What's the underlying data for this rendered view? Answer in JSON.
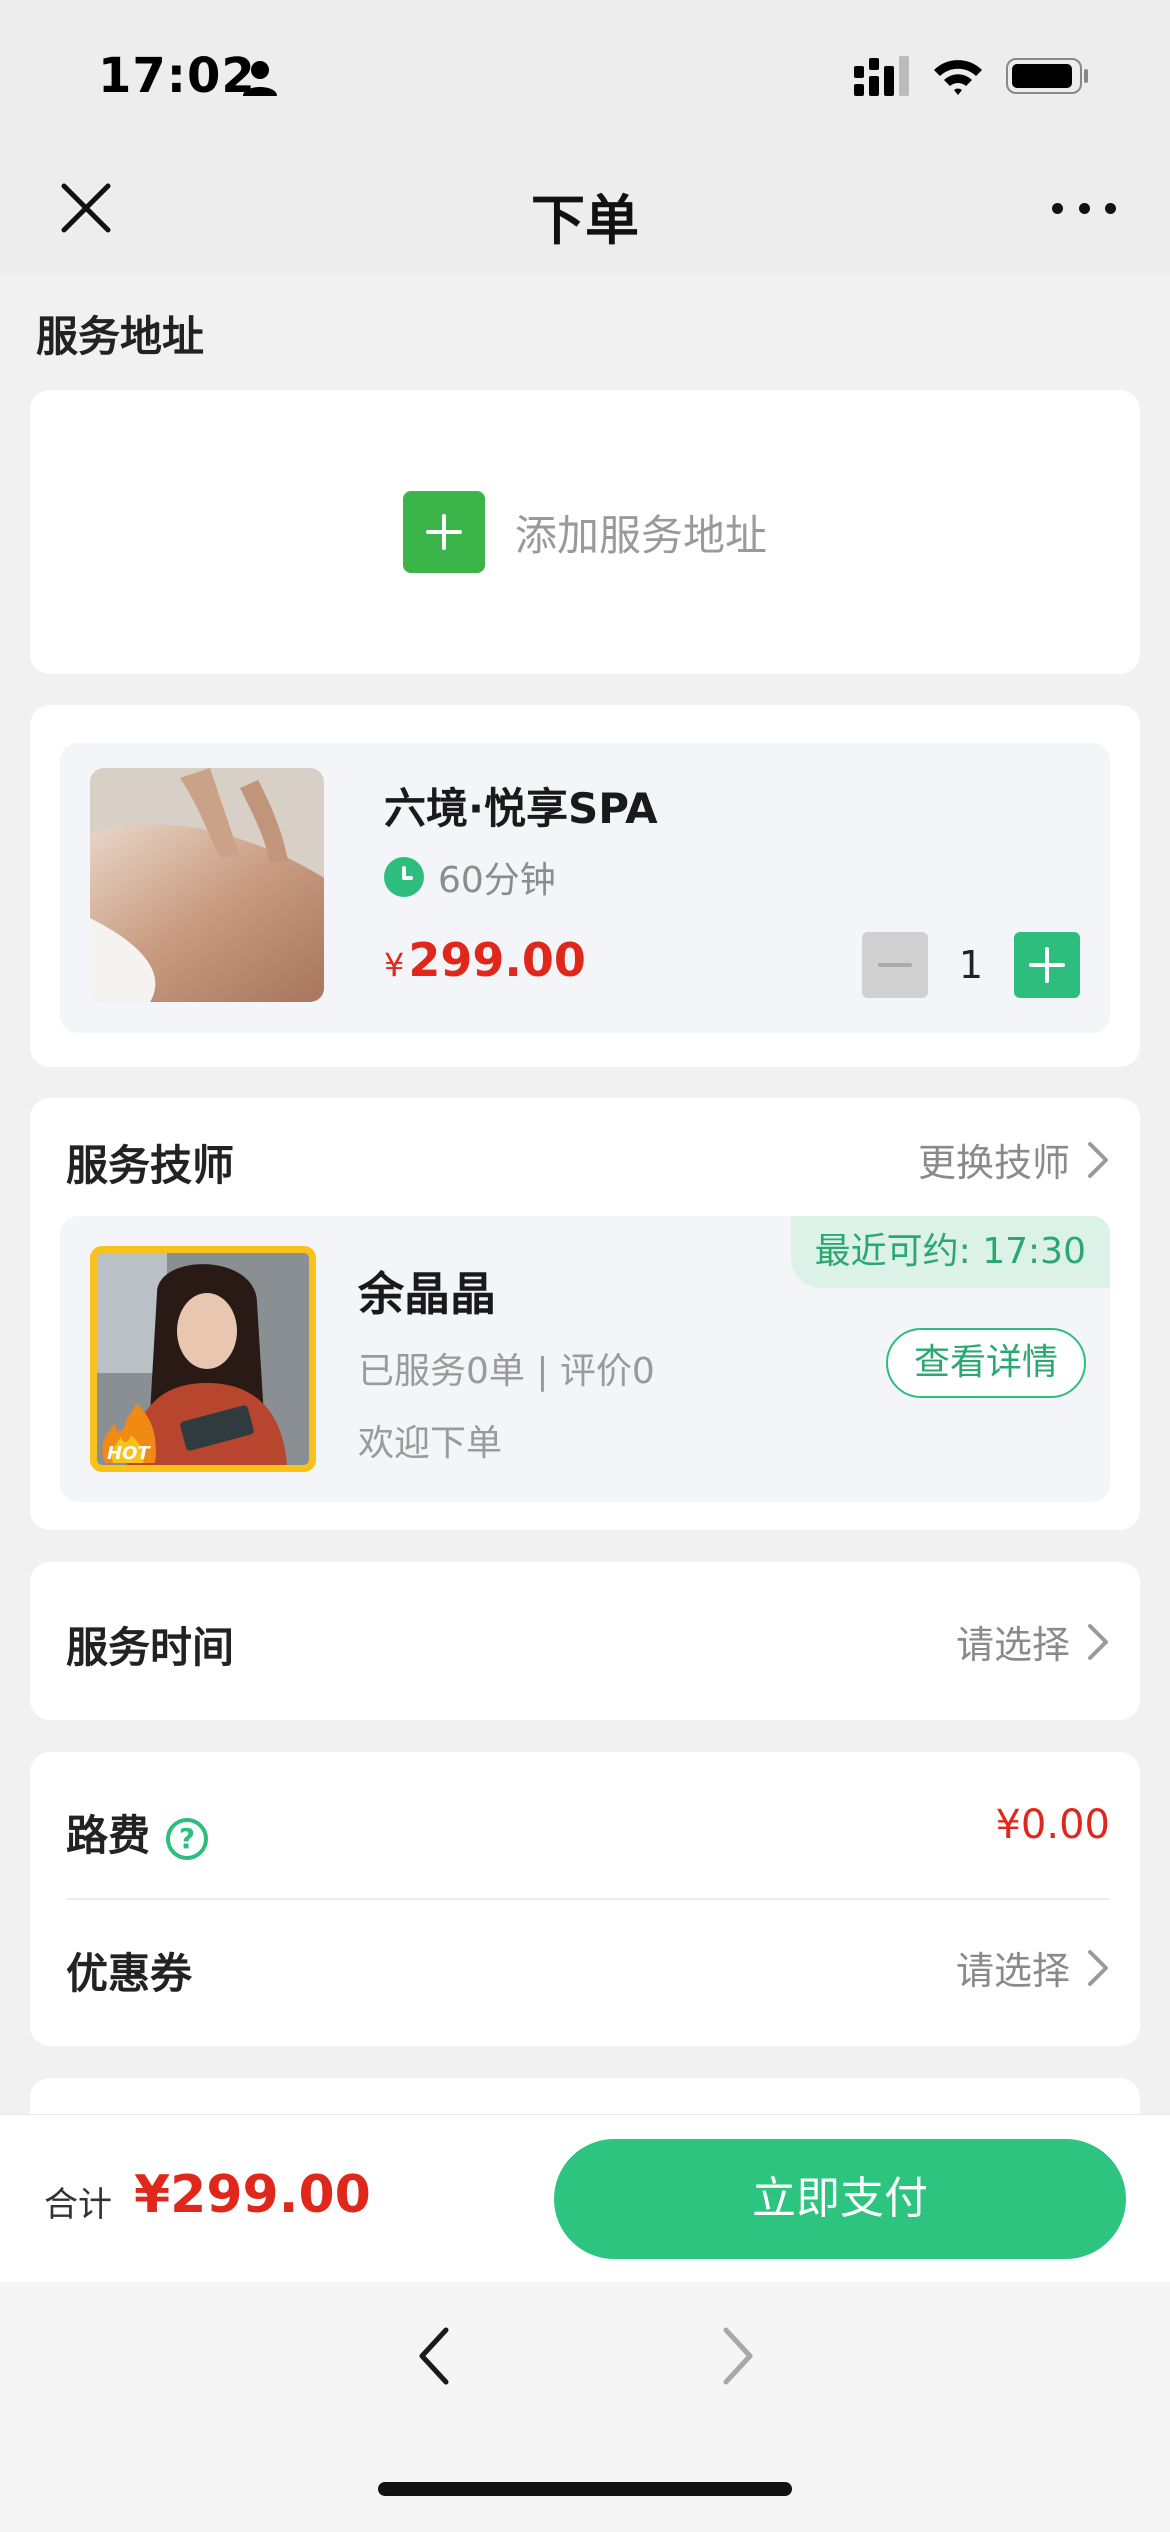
{
  "status_bar": {
    "time": "17:02"
  },
  "nav": {
    "title": "下单"
  },
  "address": {
    "section_label": "服务地址",
    "add_label": "添加服务地址"
  },
  "product": {
    "name": "六境·悦享SPA",
    "duration": "60分钟",
    "currency": "¥",
    "price": "299.00",
    "quantity": "1"
  },
  "technician": {
    "section_label": "服务技师",
    "change_label": "更换技师",
    "name": "余晶晶",
    "stats": "已服务0单 | 评价0",
    "welcome": "欢迎下单",
    "badge": "最近可约: 17:30",
    "detail_button": "查看详情",
    "hot_badge": "HOT"
  },
  "service_time": {
    "label": "服务时间",
    "value": "请选择"
  },
  "fees": {
    "travel_label": "路费",
    "travel_value": "¥0.00",
    "coupon_label": "优惠券",
    "coupon_value": "请选择"
  },
  "checkout": {
    "total_label": "合计",
    "total_value": "¥299.00",
    "pay_button": "立即支付"
  },
  "colors": {
    "accent": "#2cc47f",
    "price": "#e0271b",
    "add_green": "#3bb44a"
  }
}
